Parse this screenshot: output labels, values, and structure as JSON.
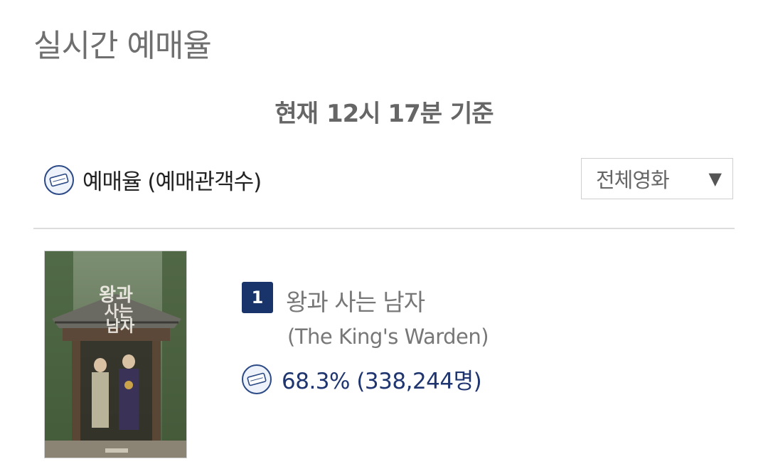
{
  "header": {
    "title": "실시간 예매율"
  },
  "timestamp": {
    "prefix": "현재",
    "time": "12시 17분",
    "suffix": "기준"
  },
  "rate_header": {
    "label": "예매율 (예매관객수)",
    "icon": "ticket-icon"
  },
  "filter": {
    "selected": "전체영화",
    "arrow": "▼"
  },
  "movies": [
    {
      "rank": "1",
      "title": "왕과 사는 남자",
      "english_title": "(The King's Warden)",
      "rate_text": "68.3% (338,244명)",
      "poster_text": "왕과 사는 남자"
    }
  ],
  "colors": {
    "accent": "#19336b",
    "rate_text": "#1f3570",
    "title_gray": "#6f6f6f"
  }
}
